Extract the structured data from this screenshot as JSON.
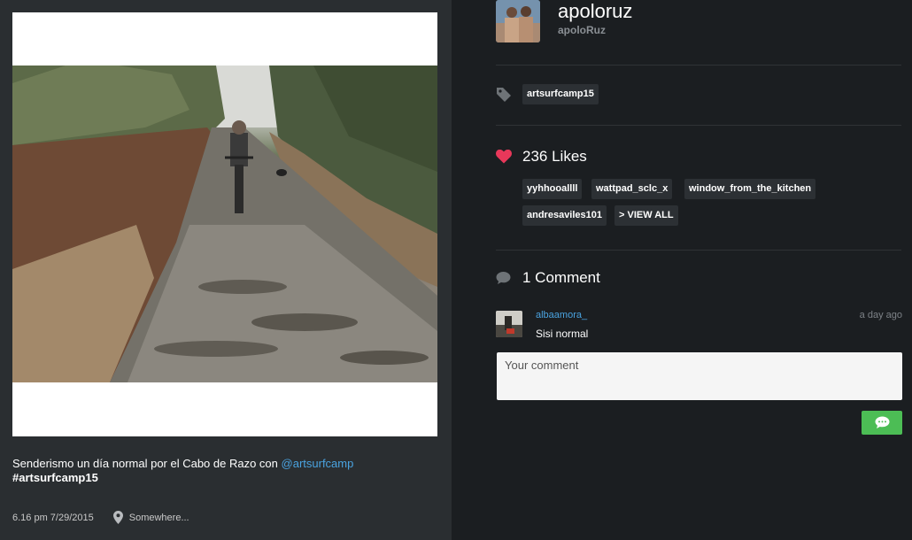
{
  "post": {
    "caption_text": "Senderismo un día normal por el Cabo de Razo con ",
    "caption_mention": "@artsurfcamp",
    "caption_hashtag": "#artsurfcamp15",
    "timestamp": "6.16 pm 7/29/2015",
    "location": "Somewhere..."
  },
  "author": {
    "display_name": "apoloruz",
    "handle": "apoloRuz"
  },
  "tags": [
    "artsurfcamp15"
  ],
  "likes": {
    "label": "236 Likes",
    "users": [
      "yyhhooallll",
      "wattpad_sclc_x",
      "window_from_the_kitchen",
      "andresaviles101"
    ],
    "view_all_label": "> VIEW ALL"
  },
  "comments": {
    "label": "1 Comment",
    "items": [
      {
        "user": "albaamora_",
        "time": "a day ago",
        "text": "Sisi normal"
      }
    ],
    "input_placeholder": "Your comment"
  },
  "colors": {
    "accent_link": "#4aa3e0",
    "heart": "#e8385a",
    "send_button": "#4cbd55",
    "panel_dark": "#1b1e21",
    "panel_left": "#2a2e31"
  },
  "icons": {
    "tag": "tag-icon",
    "heart": "heart-icon",
    "comment": "comment-bubble-icon",
    "location": "location-pin-icon",
    "send": "send-comment-icon"
  }
}
